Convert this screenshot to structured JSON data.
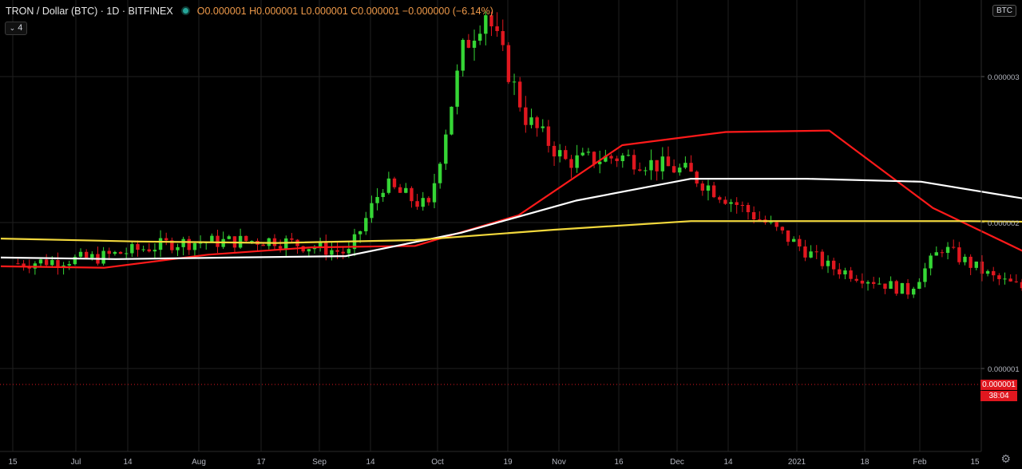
{
  "header": {
    "symbol": "TRON / Dollar (BTC) · 1D · BITFINEX",
    "ohlc": "O0.000001 H0.000001 L0.000001 C0.000001 −0.000000 (−6.14%)",
    "indicator_count": "4",
    "currency_badge": "BTC"
  },
  "price_axis": {
    "ticks": [
      "0.000003",
      "0.000002",
      "0.000001"
    ],
    "current_price": "0.000001",
    "countdown": "38:04"
  },
  "time_axis": {
    "ticks": [
      "15",
      "Jul",
      "14",
      "Aug",
      "17",
      "Sep",
      "14",
      "Oct",
      "19",
      "Nov",
      "16",
      "Dec",
      "14",
      "2021",
      "18",
      "Feb",
      "15"
    ]
  },
  "chart_data": {
    "type": "candlestick",
    "symbol": "TRON / Dollar (BTC)",
    "interval": "1D",
    "exchange": "BITFINEX",
    "x_ticks": [
      "15",
      "Jul",
      "14",
      "Aug",
      "17",
      "Sep",
      "14",
      "Oct",
      "19",
      "Nov",
      "16",
      "Dec",
      "14",
      "2021",
      "18",
      "Feb",
      "15"
    ],
    "y_ticks": [
      3e-06,
      2e-06,
      1e-06
    ],
    "ylim": [
      5.8e-07,
      3.51e-06
    ],
    "close_trend": [
      [
        "Jun 17",
        1.72e-06
      ],
      [
        "Jul 1",
        1.76e-06
      ],
      [
        "Jul 14",
        1.86e-06
      ],
      [
        "Aug 1",
        1.88e-06
      ],
      [
        "Aug 14",
        1.79e-06
      ],
      [
        "Aug 20",
        2.26e-06
      ],
      [
        "Aug 28",
        2.1e-06
      ],
      [
        "Sep 3",
        3.18e-06
      ],
      [
        "Sep 7",
        3.45e-06
      ],
      [
        "Sep 14",
        2.72e-06
      ],
      [
        "Sep 21",
        2.42e-06
      ],
      [
        "Oct 1",
        2.45e-06
      ],
      [
        "Oct 12",
        2.35e-06
      ],
      [
        "Oct 26",
        2e-06
      ],
      [
        "Nov 6",
        1.7e-06
      ],
      [
        "Nov 20",
        1.53e-06
      ],
      [
        "Nov 26",
        1.83e-06
      ],
      [
        "Dec 5",
        1.62e-06
      ],
      [
        "Dec 14",
        1.5e-06
      ],
      [
        "Dec 22",
        1.33e-06
      ],
      [
        "Jan 1",
        1.05e-06
      ],
      [
        "Jan 9",
        8.6e-07
      ],
      [
        "Jan 16",
        8.7e-07
      ],
      [
        "Jan 28",
        9.4e-07
      ],
      [
        "Feb 6",
        9.3e-07
      ]
    ],
    "series": [
      {
        "name": "",
        "color": "#ff1a1a",
        "values": [
          1.7e-06,
          1.69e-06,
          1.78e-06,
          1.83e-06,
          1.84e-06,
          2.05e-06,
          2.53e-06,
          2.62e-06,
          2.63e-06,
          2.1e-06,
          1.76e-06,
          1.45e-06,
          1.21e-06,
          9.7e-07
        ]
      },
      {
        "name": "",
        "color": "#ffffff",
        "values": [
          1.76e-06,
          1.75e-06,
          1.76e-06,
          1.77e-06,
          1.93e-06,
          2.15e-06,
          2.3e-06,
          2.3e-06,
          2.28e-06,
          2.15e-06,
          1.87e-06,
          1.52e-06,
          1.28e-06
        ]
      },
      {
        "name": "",
        "color": "#f2d83c",
        "values": [
          1.89e-06,
          1.87e-06,
          1.86e-06,
          1.88e-06,
          1.95e-06,
          2.01e-06,
          2.01e-06,
          2.01e-06,
          2e-06,
          1.93e-06,
          1.8e-06
        ]
      }
    ],
    "current_price": 1e-06,
    "current_change_pct": -6.14,
    "colors": {
      "up": "#35d635",
      "down": "#e0171f",
      "current_bar": "#26c6da",
      "grid": "#1f1f1f",
      "background": "#000000"
    }
  }
}
